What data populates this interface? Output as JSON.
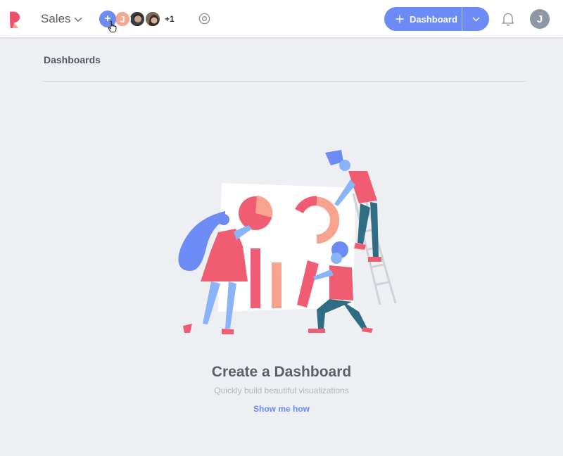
{
  "header": {
    "workspace": "Sales",
    "members": {
      "initial": "J",
      "more_count": "+1"
    },
    "add_member_symbol": "+",
    "new_dashboard_label": "Dashboard",
    "user_initial": "J"
  },
  "page": {
    "title": "Dashboards"
  },
  "empty_state": {
    "title": "Create a Dashboard",
    "subtitle": "Quickly build beautiful visualizations",
    "link": "Show me how"
  },
  "colors": {
    "accent": "#6d8bf5",
    "background": "#eeeff3",
    "pink": "#f05d73",
    "salmon": "#f7a38f"
  },
  "icons": [
    "logo-icon",
    "chevron-down-icon",
    "plus-icon",
    "hand-cursor-icon",
    "gear-icon",
    "bell-icon"
  ]
}
